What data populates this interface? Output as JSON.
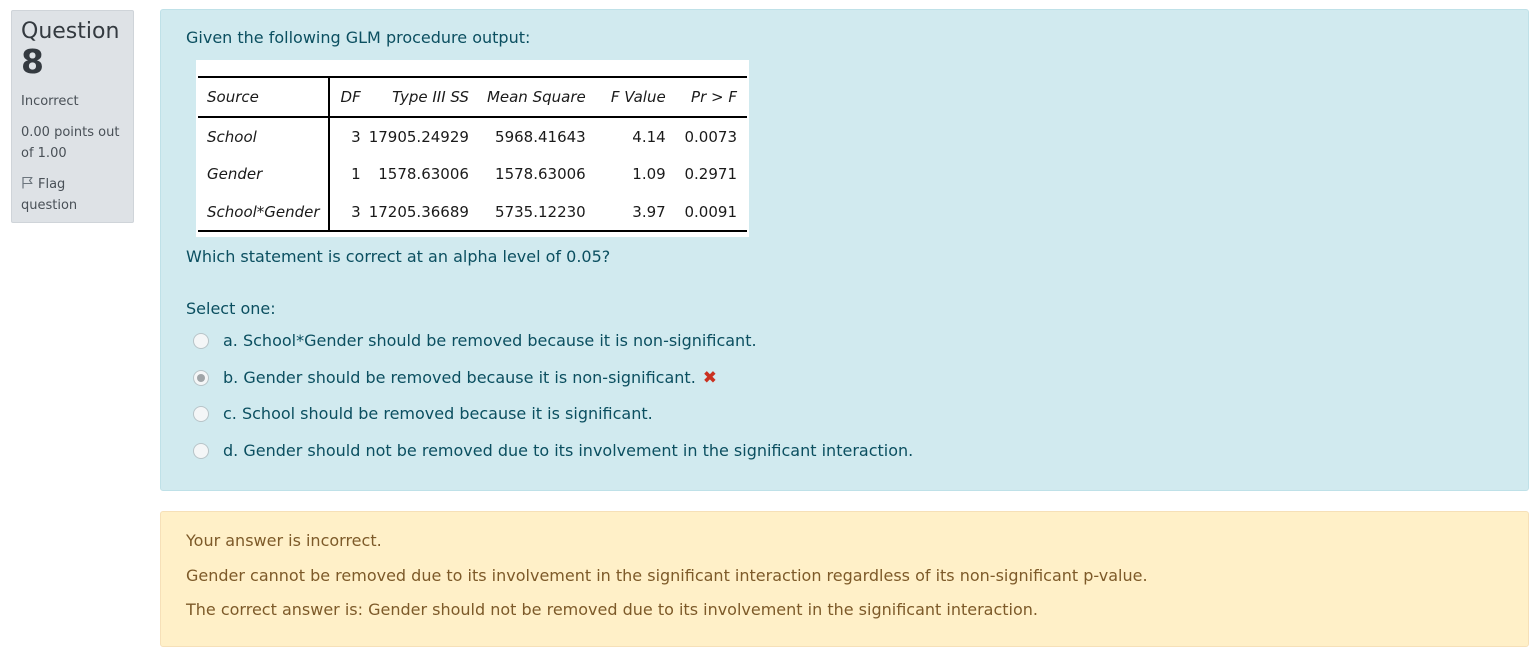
{
  "info": {
    "question_word": "Question",
    "question_number": "8",
    "state": "Incorrect",
    "grade_line1": "0.00 points out",
    "grade_line2": "of 1.00",
    "flag_line1": "Flag",
    "flag_line2": "question",
    "flag_icon": "flag-outline-icon"
  },
  "question": {
    "intro": "Given the following GLM procedure output:",
    "prompt": "Which statement is correct at an alpha level of 0.05?",
    "select_label": "Select one:",
    "table": {
      "headers": [
        "Source",
        "DF",
        "Type III SS",
        "Mean Square",
        "F Value",
        "Pr > F"
      ],
      "rows": [
        [
          "School",
          "3",
          "17905.24929",
          "5968.41643",
          "4.14",
          "0.0073"
        ],
        [
          "Gender",
          "1",
          "1578.63006",
          "1578.63006",
          "1.09",
          "0.2971"
        ],
        [
          "School*Gender",
          "3",
          "17205.36689",
          "5735.12230",
          "3.97",
          "0.0091"
        ]
      ]
    },
    "answers": [
      {
        "label": "a. School*Gender should be removed because it is non-significant.",
        "selected": false,
        "marked_wrong": false
      },
      {
        "label": "b. Gender should be removed because it is non-significant.",
        "selected": true,
        "marked_wrong": true
      },
      {
        "label": "c. School should be removed because it is significant.",
        "selected": false,
        "marked_wrong": false
      },
      {
        "label": "d. Gender should not be removed due to its involvement in the significant interaction.",
        "selected": false,
        "marked_wrong": false
      }
    ],
    "wrong_mark": "✖",
    "wrong_icon": "cross-icon"
  },
  "feedback": {
    "status": "Your answer is incorrect.",
    "explanation": "Gender cannot be removed due to its involvement in the significant interaction regardless of its non-significant p-value.",
    "correct": "The correct answer is: Gender should not be removed due to its involvement in the significant interaction."
  },
  "colors": {
    "info_bg": "#dee2e6",
    "question_bg": "#d1eaef",
    "question_text": "#0b4f60",
    "feedback_bg": "#fff0c8",
    "feedback_text": "#7d5a29",
    "wrong": "#ca3120"
  }
}
